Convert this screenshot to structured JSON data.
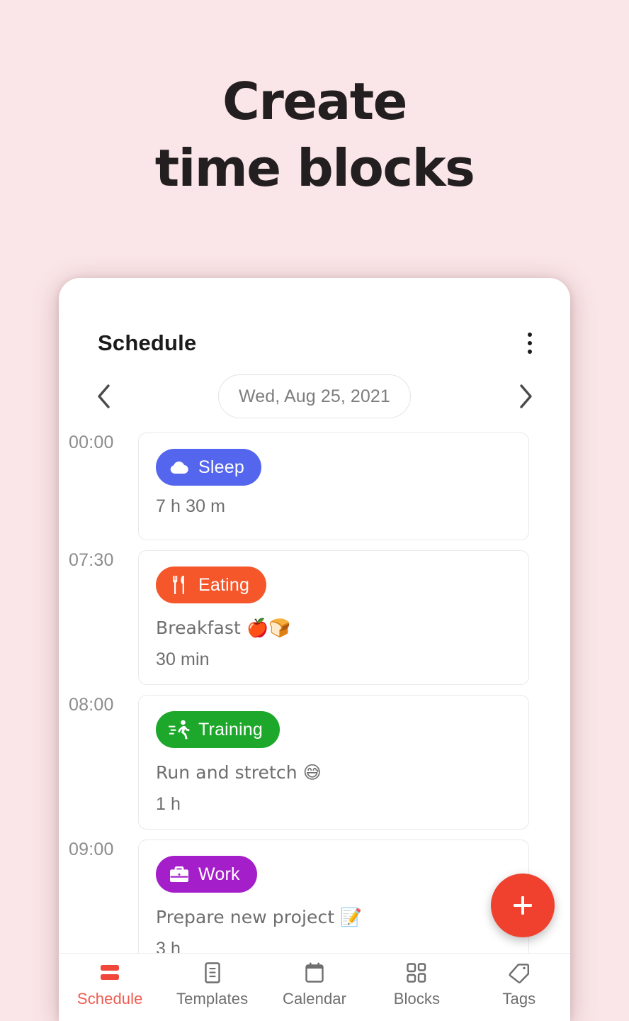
{
  "promo": {
    "line1": "Create",
    "line2": "time blocks"
  },
  "app": {
    "title": "Schedule",
    "menu_icon": "kebab-menu-icon",
    "date": {
      "prev_icon": "chevron-left-icon",
      "value": "Wed, Aug 25, 2021",
      "next_icon": "chevron-right-icon"
    },
    "fab": {
      "icon": "plus-icon",
      "color": "#F0402E",
      "label": "+"
    },
    "blocks": [
      {
        "time": "00:00",
        "tag": "Sleep",
        "tag_icon": "cloud-icon",
        "color": "#5566EE",
        "note": "",
        "duration": "7 h 30 m"
      },
      {
        "time": "07:30",
        "tag": "Eating",
        "tag_icon": "fork-knife-icon",
        "color": "#F5562A",
        "note": "Breakfast 🍎🍞",
        "duration": "30 min"
      },
      {
        "time": "08:00",
        "tag": "Training",
        "tag_icon": "running-person-icon",
        "color": "#1DA82B",
        "note": "Run and stretch 😅",
        "duration": "1 h"
      },
      {
        "time": "09:00",
        "tag": "Work",
        "tag_icon": "briefcase-icon",
        "color": "#A41FC9",
        "note": "Prepare new project 📝",
        "duration": "3 h"
      }
    ],
    "bottom_nav": {
      "active": "Schedule",
      "active_color": "#F05B4F",
      "items": [
        {
          "label": "Schedule",
          "icon": "schedule-bars-icon"
        },
        {
          "label": "Templates",
          "icon": "document-lines-icon"
        },
        {
          "label": "Calendar",
          "icon": "calendar-icon"
        },
        {
          "label": "Blocks",
          "icon": "grid-blocks-icon"
        },
        {
          "label": "Tags",
          "icon": "tag-icon"
        }
      ]
    }
  },
  "theme": {
    "background": "#FAE6E8",
    "phone_surface": "#FFFFFF"
  }
}
